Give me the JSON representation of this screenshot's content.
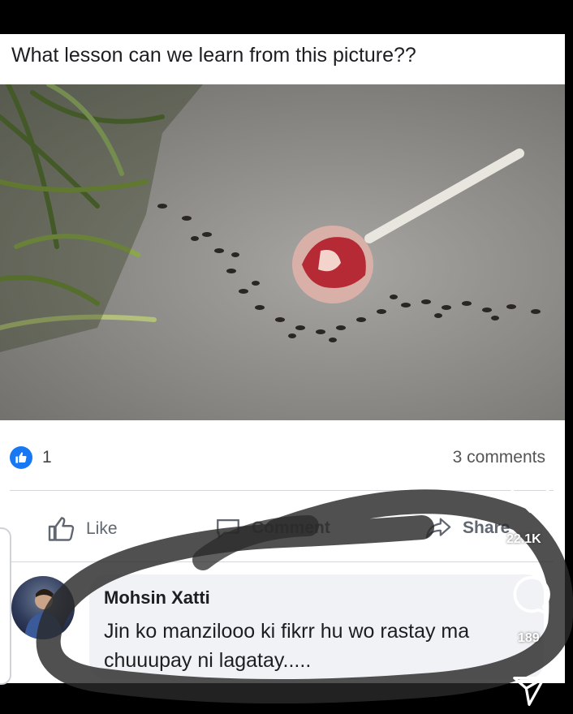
{
  "post": {
    "caption": "What lesson can we learn from this picture??",
    "image_alt": "ants marching around a lollipop"
  },
  "reactions": {
    "like_count": "1",
    "comments_count": "3 comments"
  },
  "actions": {
    "like_label": "Like",
    "comment_label": "Comment",
    "share_label": "Share"
  },
  "comment": {
    "author": "Mohsin Xatti",
    "text": "Jin ko manzilooo ki fikrr hu wo rastay ma chuuupay ni lagatay....."
  },
  "overlay": {
    "likes_count": "22.1K",
    "comments_count": "189"
  },
  "colors": {
    "facebook_blue": "#1877f2",
    "bubble_bg": "#f0f2f5",
    "scribble": "#2a2a2a"
  }
}
